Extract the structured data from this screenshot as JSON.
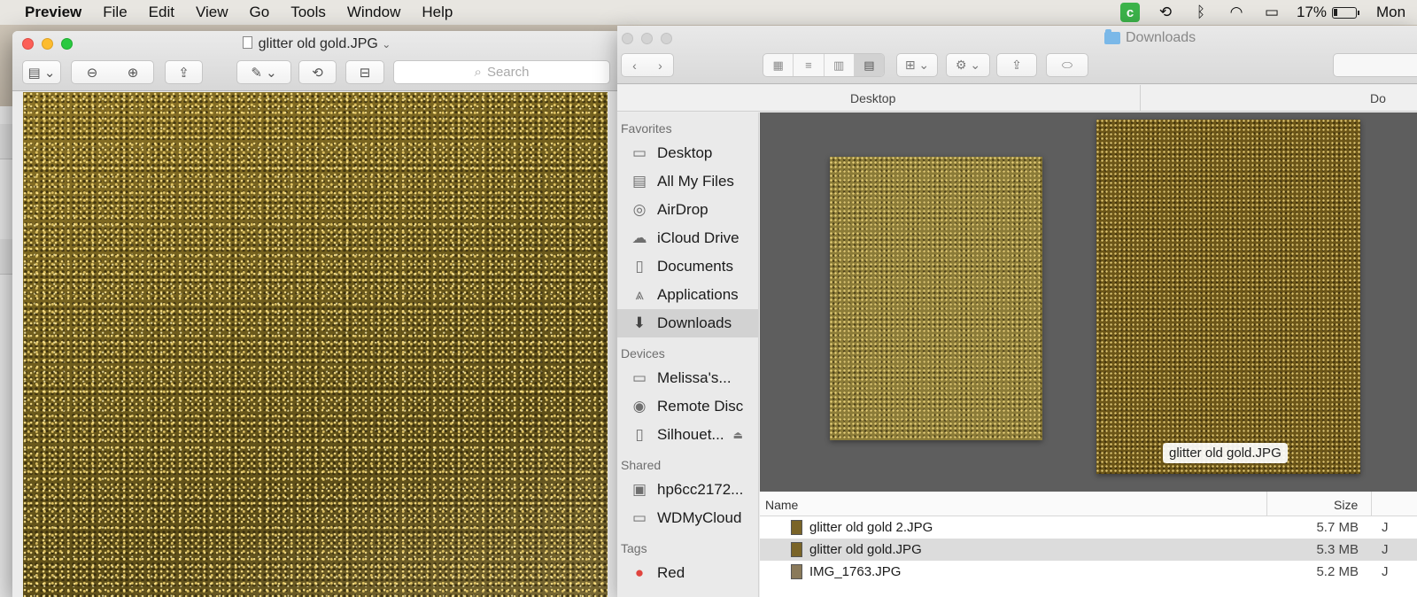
{
  "menubar": {
    "app_name": "Preview",
    "items": [
      "File",
      "Edit",
      "View",
      "Go",
      "Tools",
      "Window",
      "Help"
    ],
    "battery_percent": "17%",
    "clock": "Mon"
  },
  "preview": {
    "title": "glitter old gold.JPG",
    "search_placeholder": "Search"
  },
  "finder": {
    "title": "Downloads",
    "path_columns": [
      "Desktop",
      "Do"
    ],
    "sidebar": {
      "favorites_header": "Favorites",
      "favorites": [
        "Desktop",
        "All My Files",
        "AirDrop",
        "iCloud Drive",
        "Documents",
        "Applications",
        "Downloads"
      ],
      "devices_header": "Devices",
      "devices": [
        "Melissa's...",
        "Remote Disc",
        "Silhouet..."
      ],
      "shared_header": "Shared",
      "shared": [
        "hp6cc2172...",
        "WDMyCloud"
      ],
      "tags_header": "Tags",
      "tags": [
        "Red"
      ]
    },
    "coverflow_label": "glitter old gold.JPG",
    "list": {
      "col_name": "Name",
      "col_size": "Size",
      "rows": [
        {
          "name": "glitter old gold 2.JPG",
          "size": "5.7 MB",
          "kind": "J"
        },
        {
          "name": "glitter old gold.JPG",
          "size": "5.3 MB",
          "kind": "J"
        },
        {
          "name": "IMG_1763.JPG",
          "size": "5.2 MB",
          "kind": "J"
        }
      ]
    }
  }
}
